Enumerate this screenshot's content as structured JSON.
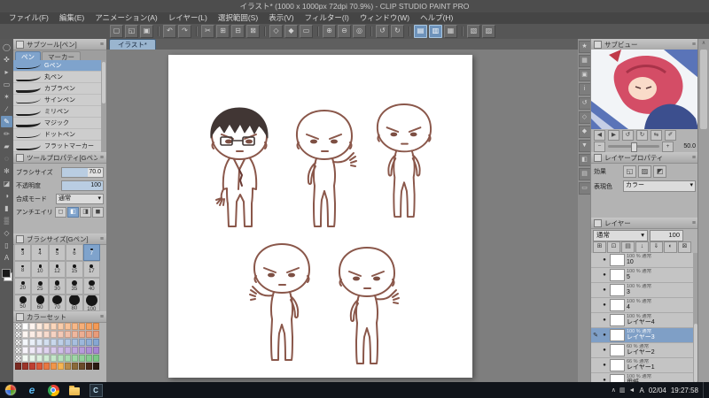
{
  "theme": {
    "accent": "#6e93bb",
    "selection": "#7fa3cc",
    "line_art": "#8a574a",
    "hair": "#413634"
  },
  "titlebar": {
    "title": "イラスト* (1000 x 1000px 72dpi 70.9%) - CLIP STUDIO PAINT PRO"
  },
  "menubar": {
    "items": [
      "ファイル(F)",
      "編集(E)",
      "アニメーション(A)",
      "レイヤー(L)",
      "選択範囲(S)",
      "表示(V)",
      "フィルター(I)",
      "ウィンドウ(W)",
      "ヘルプ(H)"
    ]
  },
  "toolbar": {
    "items": [
      {
        "name": "new-file-icon",
        "glyph": "▢"
      },
      {
        "name": "open-file-icon",
        "glyph": "◱"
      },
      {
        "name": "save-file-icon",
        "glyph": "▣"
      },
      {
        "sep": true
      },
      {
        "name": "undo-icon",
        "glyph": "↶"
      },
      {
        "name": "redo-icon",
        "glyph": "↷"
      },
      {
        "sep": true
      },
      {
        "name": "cut-icon",
        "glyph": "✂"
      },
      {
        "name": "copy-icon",
        "glyph": "⊞"
      },
      {
        "name": "paste-icon",
        "glyph": "⊟"
      },
      {
        "name": "delete-icon",
        "glyph": "⊠"
      },
      {
        "sep": true
      },
      {
        "name": "deselect-icon",
        "glyph": "◇"
      },
      {
        "name": "invert-selection-icon",
        "glyph": "◆"
      },
      {
        "name": "selection-border-icon",
        "glyph": "▭"
      },
      {
        "sep": true
      },
      {
        "name": "zoom-in-icon",
        "glyph": "⊕"
      },
      {
        "name": "zoom-out-icon",
        "glyph": "⊖"
      },
      {
        "name": "fit-to-screen-icon",
        "glyph": "◎"
      },
      {
        "sep": true
      },
      {
        "name": "rotate-left-icon",
        "glyph": "↺"
      },
      {
        "name": "rotate-right-icon",
        "glyph": "↻"
      },
      {
        "sep": true
      },
      {
        "name": "snap-to-ruler-icon",
        "glyph": "▤",
        "active": true
      },
      {
        "name": "snap-to-special-ruler-icon",
        "glyph": "▥",
        "active": true
      },
      {
        "name": "snap-to-grid-icon",
        "glyph": "▦"
      },
      {
        "sep": true
      },
      {
        "name": "show-grid-icon",
        "glyph": "▧"
      },
      {
        "name": "show-material-icon",
        "glyph": "▨"
      }
    ]
  },
  "tool_strip": {
    "items": [
      {
        "name": "zoom-tool",
        "glyph": "◯"
      },
      {
        "name": "move-tool",
        "glyph": "✜"
      },
      {
        "name": "operation-tool",
        "glyph": "▸"
      },
      {
        "name": "selection-tool",
        "glyph": "▭"
      },
      {
        "name": "auto-select-tool",
        "glyph": "✶"
      },
      {
        "name": "eyedropper-tool",
        "glyph": "∕"
      },
      {
        "name": "pen-tool",
        "glyph": "✎",
        "active": true
      },
      {
        "name": "pencil-tool",
        "glyph": "✏"
      },
      {
        "name": "brush-tool",
        "glyph": "▰"
      },
      {
        "name": "airbrush-tool",
        "glyph": "◌"
      },
      {
        "name": "decoration-tool",
        "glyph": "✻"
      },
      {
        "name": "eraser-tool",
        "glyph": "◪"
      },
      {
        "name": "blend-tool",
        "glyph": "◑"
      },
      {
        "name": "fill-tool",
        "glyph": "▮"
      },
      {
        "name": "gradient-tool",
        "glyph": "▒"
      },
      {
        "name": "figure-tool",
        "glyph": "◇"
      },
      {
        "name": "frame-border-tool",
        "glyph": "▯"
      },
      {
        "name": "text-tool",
        "glyph": "A"
      }
    ]
  },
  "subtool": {
    "title": "サブツール[ペン]",
    "tabs": [
      "ペン",
      "マーカー"
    ],
    "active_tab": 0,
    "selected": 0,
    "items": [
      "Gペン",
      "丸ペン",
      "カブラペン",
      "サインペン",
      "ミリペン",
      "マジック",
      "ドットペン",
      "フラットマーカー"
    ]
  },
  "tool_property": {
    "title": "ツールプロパティ[Gペン]",
    "brush_size_label": "ブラシサイズ",
    "brush_size_value": "70.0",
    "opacity_label": "不透明度",
    "opacity_value": "100",
    "blend_label": "合成モード",
    "blend_value": "通常",
    "aa_label": "アンチエイリアス",
    "aa_options": [
      "◻",
      "◧",
      "◨",
      "◼"
    ],
    "aa_selected": 1
  },
  "brush_size": {
    "title": "ブラシサイズ[Gペン]",
    "sizes": [
      3,
      4,
      5,
      6,
      7,
      8,
      10,
      12,
      15,
      17,
      20,
      25,
      30,
      35,
      40,
      50,
      60,
      70,
      80,
      100
    ],
    "selected": 7
  },
  "color_set": {
    "title": "カラーセット",
    "colors": [
      "transparent",
      "#ffffff",
      "#fdf4ef",
      "#fceadd",
      "#fbe0cc",
      "#fad6bb",
      "#f9ccaa",
      "#f8c299",
      "#f7b888",
      "#f6ae77",
      "#f5a466",
      "#f49a55",
      "transparent",
      "#fdf6f2",
      "#fbede6",
      "#f9e4da",
      "#f7dbce",
      "#f5d2c2",
      "#f3c9b6",
      "#f1c0aa",
      "#efb79e",
      "#edae92",
      "#eba586",
      "#e99c7a",
      "transparent",
      "#f4f7fb",
      "#e9eff7",
      "#dee7f3",
      "#d3dfef",
      "#c8d7eb",
      "#bdcfe7",
      "#b2c7e3",
      "#a7bfdf",
      "#9cb7db",
      "#91afd7",
      "#86a7d3",
      "transparent",
      "#f7f4fb",
      "#efe9f7",
      "#e7def3",
      "#dfd3ef",
      "#d7c8eb",
      "#cfbde7",
      "#c7b2e3",
      "#bfa7df",
      "#b79cdb",
      "#af91d7",
      "#a786d3",
      "transparent",
      "#f3faf4",
      "#e7f5e9",
      "#dbf0de",
      "#cfebd3",
      "#c3e6c8",
      "#b7e1bd",
      "#abdcb2",
      "#9fd7a7",
      "#93d29c",
      "#87cd91",
      "#7bc886",
      "#7a2a22",
      "#9c352a",
      "#be4032",
      "#d95a3a",
      "#e87842",
      "#f0964a",
      "#f5b452",
      "#b88a4a",
      "#8a6a3a",
      "#6a4a2a",
      "#4a2a1a",
      "#2a1a12"
    ]
  },
  "canvas_tab": {
    "label": "イラスト*"
  },
  "right_strip": {
    "items": [
      {
        "name": "quick-access-icon",
        "glyph": "★"
      },
      {
        "name": "navigator-icon",
        "glyph": "▦"
      },
      {
        "name": "subview-icon",
        "glyph": "▣"
      },
      {
        "name": "information-icon",
        "glyph": "i"
      },
      {
        "name": "history-icon",
        "glyph": "↺"
      },
      {
        "name": "material-color-icon",
        "glyph": "◇"
      },
      {
        "name": "material-monochrome-icon",
        "glyph": "◆"
      },
      {
        "name": "material-download-icon",
        "glyph": "▼"
      },
      {
        "name": "layer-property-icon",
        "glyph": "◧"
      },
      {
        "name": "layer-palette-icon",
        "glyph": "▤"
      },
      {
        "name": "timeline-icon",
        "glyph": "▭"
      }
    ]
  },
  "subview": {
    "title": "サブビュー",
    "zoom_value": "50.0",
    "zoom_out_glyph": "−",
    "zoom_in_glyph": "+",
    "controls": [
      {
        "name": "previous-image-icon",
        "glyph": "◀"
      },
      {
        "name": "next-image-icon",
        "glyph": "▶"
      },
      {
        "name": "rotate-left-icon",
        "glyph": "↺"
      },
      {
        "name": "rotate-right-icon",
        "glyph": "↻"
      },
      {
        "name": "flip-horizontal-icon",
        "glyph": "⇆"
      },
      {
        "name": "eyedropper-toggle-icon",
        "glyph": "✐"
      }
    ]
  },
  "layer_property": {
    "title": "レイヤープロパティ",
    "effect_label": "効果",
    "effect_icons": [
      {
        "name": "border-effect-icon",
        "glyph": "◱"
      },
      {
        "name": "tone-effect-icon",
        "glyph": "▨"
      },
      {
        "name": "layer-color-effect-icon",
        "glyph": "◩"
      }
    ],
    "expression_label": "表現色",
    "expression_value": "カラー"
  },
  "layers": {
    "title": "レイヤー",
    "blend_value": "通常",
    "opacity_value": "100",
    "toolbar_icons": [
      {
        "name": "new-raster-layer-icon",
        "glyph": "⊞"
      },
      {
        "name": "new-vector-layer-icon",
        "glyph": "⊡"
      },
      {
        "name": "new-folder-icon",
        "glyph": "▤"
      },
      {
        "name": "transfer-to-lower-icon",
        "glyph": "↓"
      },
      {
        "name": "merge-to-lower-icon",
        "glyph": "⇓"
      },
      {
        "name": "layer-mask-icon",
        "glyph": "◐"
      },
      {
        "name": "delete-layer-icon",
        "glyph": "⊠"
      }
    ],
    "items": [
      {
        "meta": "100 % 通常",
        "name": "10",
        "selected": false
      },
      {
        "meta": "100 % 通常",
        "name": "5",
        "selected": false
      },
      {
        "meta": "100 % 通常",
        "name": "3",
        "selected": false
      },
      {
        "meta": "100 % 通常",
        "name": "4",
        "selected": false
      },
      {
        "meta": "100 % 通常",
        "name": "レイヤー4",
        "selected": false
      },
      {
        "meta": "100 % 通常",
        "name": "レイヤー3",
        "selected": true
      },
      {
        "meta": "60 % 通常",
        "name": "レイヤー2",
        "selected": false
      },
      {
        "meta": "66 % 通常",
        "name": "レイヤー1",
        "selected": false
      },
      {
        "meta": "100 % 通常",
        "name": "用紙",
        "selected": false
      }
    ]
  },
  "taskbar": {
    "apps": [
      {
        "name": "internet-explorer-icon",
        "glyph": "e",
        "cls": "ie"
      },
      {
        "name": "chrome-icon",
        "glyph": "",
        "cls": "chrome"
      },
      {
        "name": "file-explorer-icon",
        "glyph": "",
        "cls": "folder"
      },
      {
        "name": "clip-studio-icon",
        "glyph": "C",
        "cls": "csp"
      }
    ],
    "tray_icons": [
      {
        "name": "tray-overflow-icon",
        "glyph": "∧"
      },
      {
        "name": "network-icon",
        "glyph": "▥"
      },
      {
        "name": "volume-icon",
        "glyph": "◄"
      }
    ],
    "ime": "A",
    "date": "02/04",
    "time": "19:27:58"
  }
}
